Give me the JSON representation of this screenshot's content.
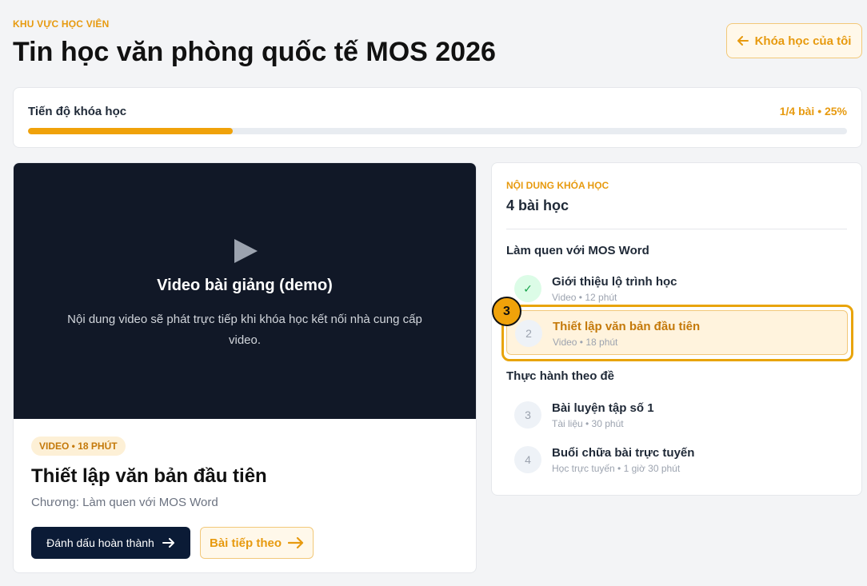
{
  "header": {
    "eyebrow": "KHU VỰC HỌC VIÊN",
    "title": "Tin học văn phòng quốc tế MOS 2026",
    "my_courses_label": "Khóa học của tôi",
    "my_courses_icon": "arrow-left-icon"
  },
  "progress": {
    "label": "Tiến độ khóa học",
    "stat": "1/4 bài • 25%",
    "percent": 25
  },
  "player": {
    "play_icon": "play-icon",
    "title": "Video bài giảng (demo)",
    "description": "Nội dung video sẽ phát trực tiếp khi khóa học kết nối nhà cung cấp video."
  },
  "lesson": {
    "meta": "VIDEO • 18 PHÚT",
    "title": "Thiết lập văn bản đầu tiên",
    "chapter": "Chương: Làm quen với MOS Word",
    "mark_done_label": "Đánh dấu hoàn thành",
    "next_label": "Bài tiếp theo"
  },
  "outline": {
    "eyebrow": "NỘI DUNG KHÓA HỌC",
    "count": "4 bài học",
    "sections": [
      {
        "title": "Làm quen với MOS Word",
        "items": [
          {
            "num": "✓",
            "title": "Giới thiệu lộ trình học",
            "sub": "Video • 12 phút",
            "status": "done"
          },
          {
            "num": "2",
            "title": "Thiết lập văn bản đầu tiên",
            "sub": "Video • 18 phút",
            "status": "active"
          }
        ]
      },
      {
        "title": "Thực hành theo đề",
        "items": [
          {
            "num": "3",
            "title": "Bài luyện tập số 1",
            "sub": "Tài liệu • 30 phút",
            "status": "pending"
          },
          {
            "num": "4",
            "title": "Buổi chữa bài trực tuyến",
            "sub": "Học trực tuyến • 1 giờ 30 phút",
            "status": "pending"
          }
        ]
      }
    ]
  },
  "step_marker": "3",
  "colors": {
    "accent": "#f0a20a",
    "dark": "#111827",
    "navy": "#0b1b36",
    "done": "#16a34a"
  }
}
